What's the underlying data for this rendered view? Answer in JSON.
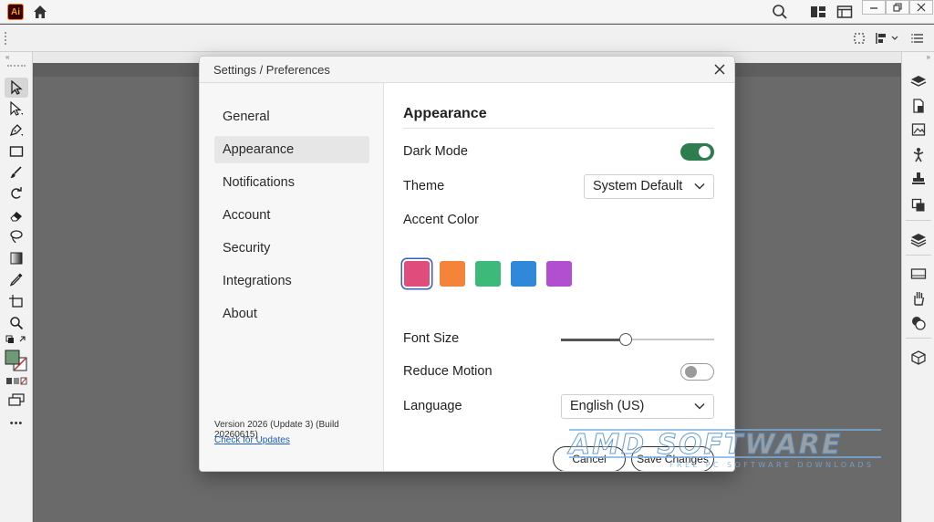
{
  "app": {
    "logo": "Ai",
    "icons": [
      "home-icon",
      "search-icon",
      "workspace-layout-icon",
      "arrange-documents-icon"
    ],
    "window_controls": [
      "minimize-icon",
      "restore-icon",
      "close-icon"
    ]
  },
  "left_toolbar": {
    "collapse": "«",
    "tools": [
      "selection-tool",
      "direct-selection-tool",
      "pen-tool",
      "rectangle-tool",
      "paintbrush-tool",
      "rotate-tool",
      "eraser-tool",
      "lasso-tool",
      "gradient-tool",
      "eyedropper-tool",
      "artboard-tool",
      "zoom-tool"
    ],
    "more": "•••"
  },
  "right_panel": {
    "collapse": "»",
    "icons": [
      "layers-icon",
      "document-icon",
      "image-icon",
      "puppet-icon",
      "stamp-icon",
      "arrange-icon",
      "layers-stack-icon",
      "rectangle-outline-icon",
      "glove-icon",
      "shapes-icon",
      "cube-icon"
    ]
  },
  "dialog": {
    "title": "Settings / Preferences",
    "close_label": "✕",
    "nav": {
      "items": [
        {
          "label": "General"
        },
        {
          "label": "Appearance",
          "selected": true
        },
        {
          "label": "Notifications"
        },
        {
          "label": "Account"
        },
        {
          "label": "Security"
        },
        {
          "label": "Integrations"
        },
        {
          "label": "About"
        }
      ],
      "version": "Version 2026 (Update 3) (Build 20260615)",
      "update_link": "Check for Updates"
    },
    "appearance": {
      "title": "Appearance",
      "dark_mode": {
        "label": "Dark Mode",
        "on": true
      },
      "theme": {
        "label": "Theme",
        "value": "System Default"
      },
      "accent": {
        "label": "Accent Color",
        "colors": [
          "#e04c7b",
          "#f5843a",
          "#3db97a",
          "#2f88da",
          "#b14fd0"
        ],
        "selected_index": 0
      },
      "font_size": {
        "label": "Font Size",
        "value_fraction": 0.42
      },
      "reduce_motion": {
        "label": "Reduce Motion",
        "on": false
      },
      "language": {
        "label": "Language",
        "value": "English (US)"
      }
    },
    "buttons": {
      "cancel": "Cancel",
      "save": "Save Changes"
    },
    "accent_toggle_color": "#2d7d4f"
  },
  "watermark": {
    "main": "AMD SOFTWARE",
    "sub": "FREE PC SOFTWARE DOWNLOADS"
  }
}
